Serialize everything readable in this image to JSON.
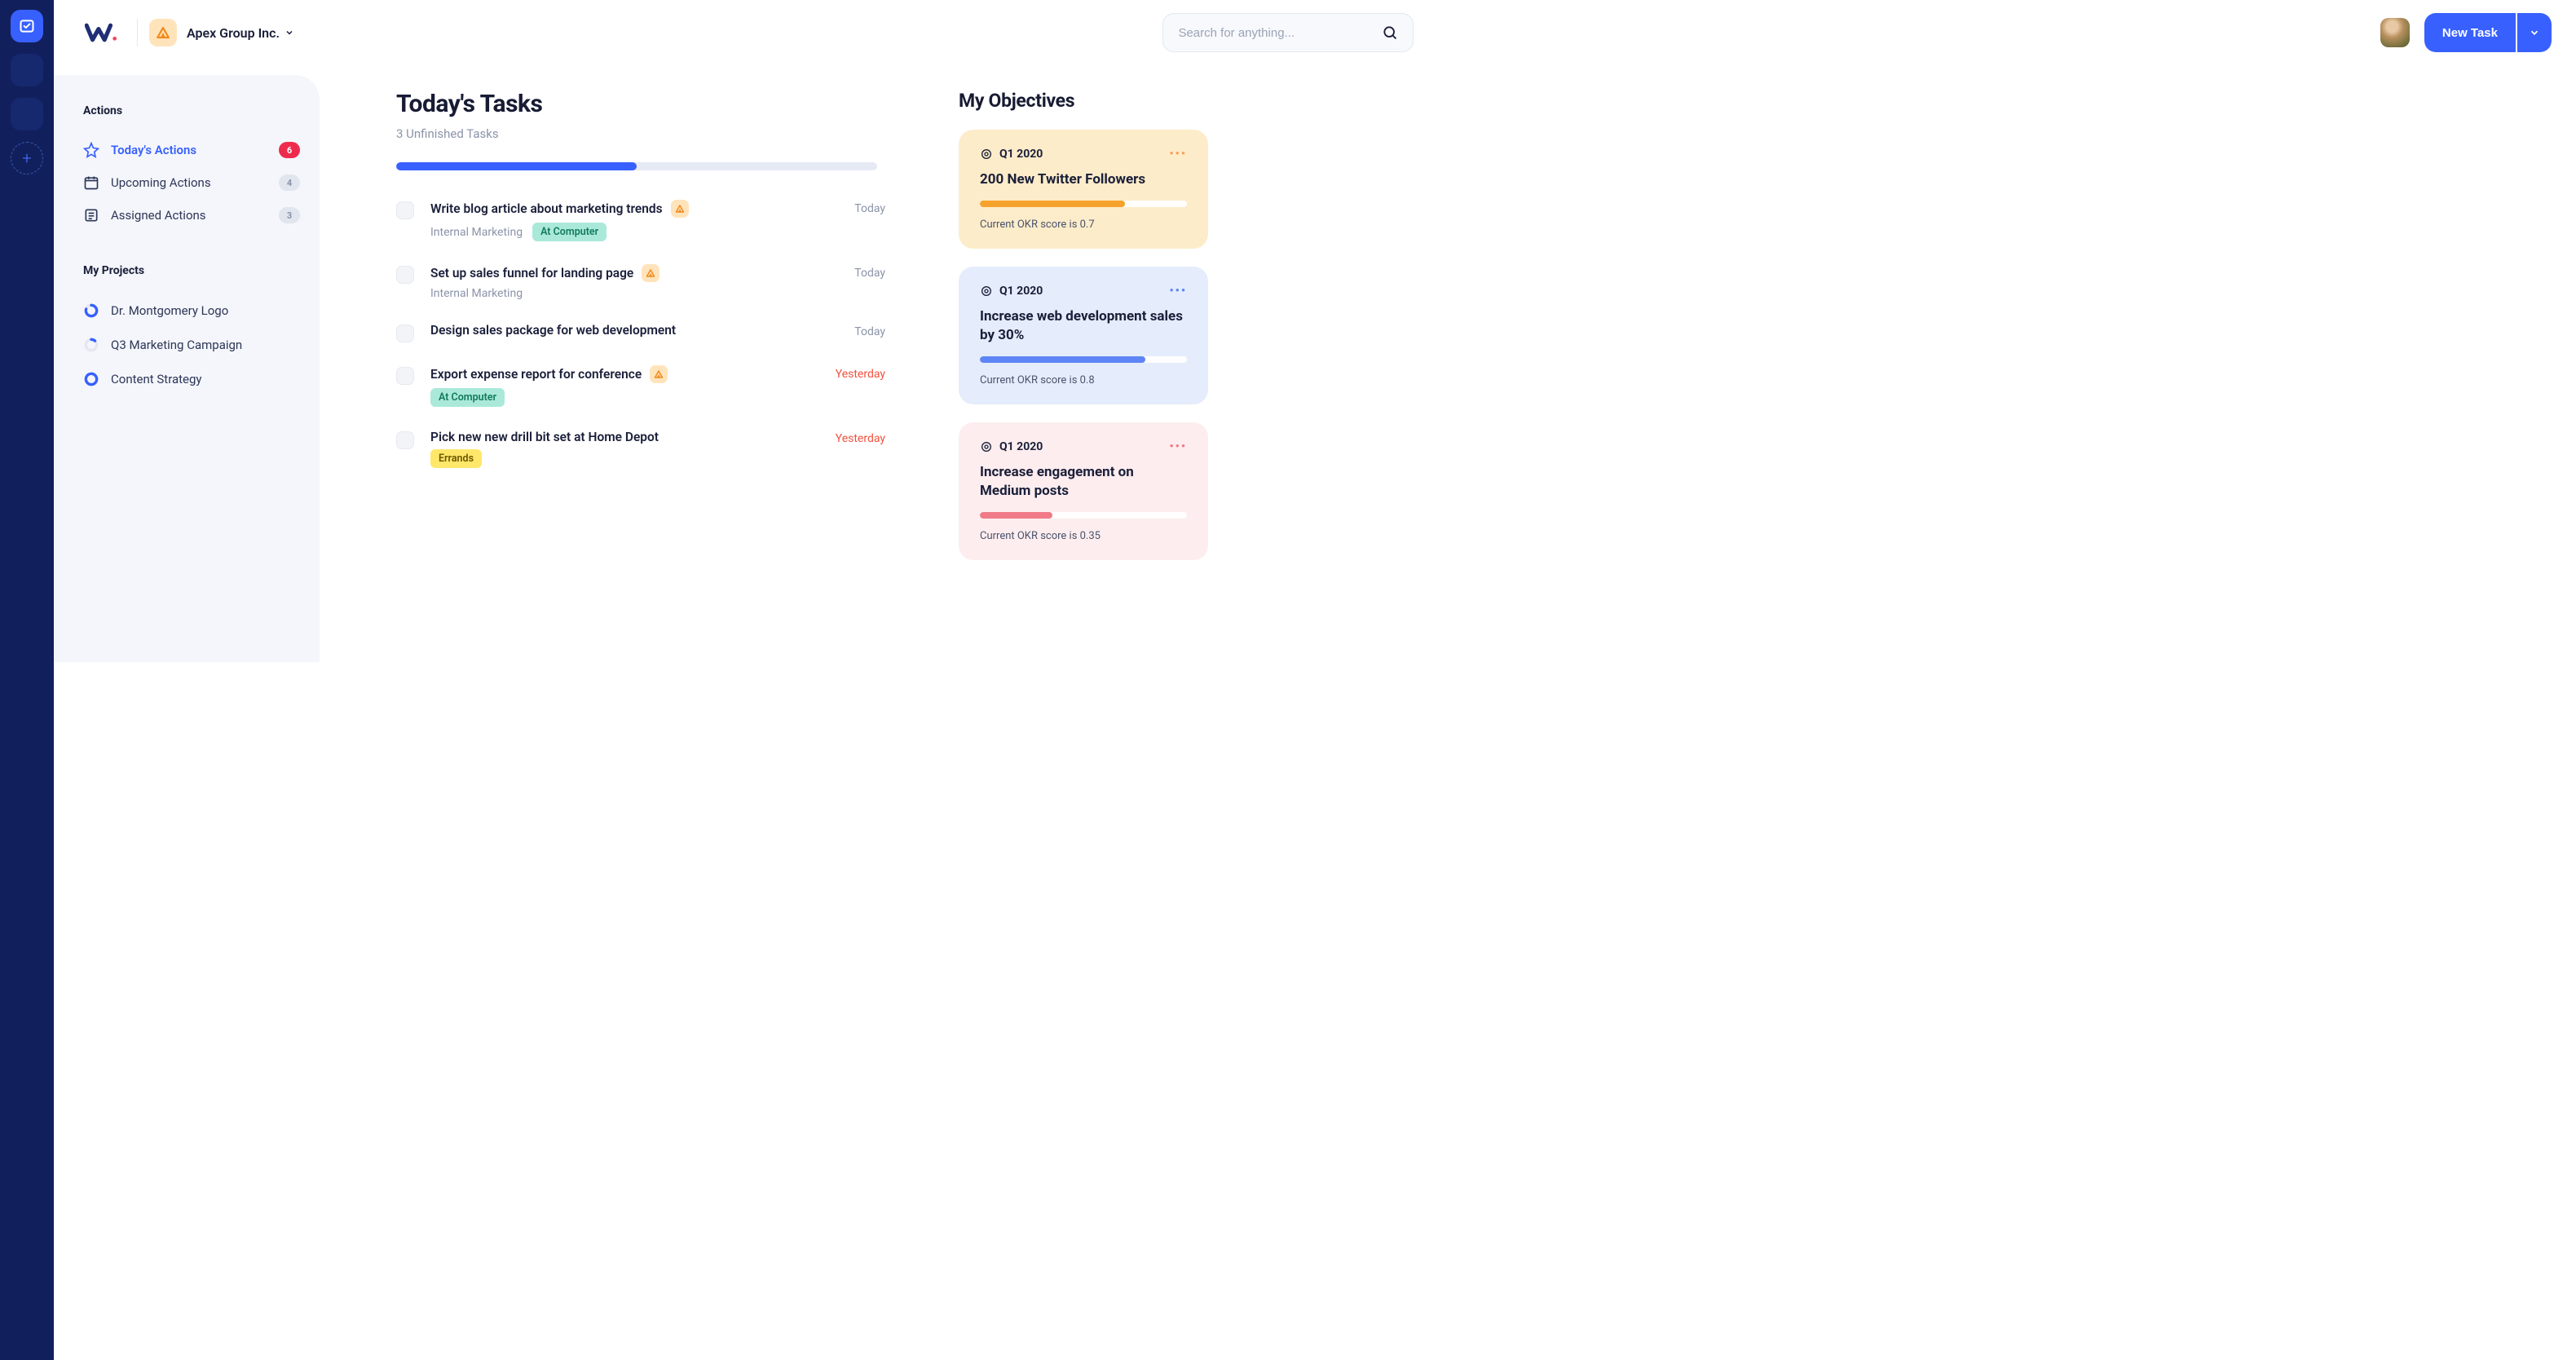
{
  "rail": {
    "plus": "+"
  },
  "header": {
    "org_name": "Apex Group Inc.",
    "search_placeholder": "Search for anything...",
    "new_task_label": "New Task"
  },
  "sidebar": {
    "actions_header": "Actions",
    "items": [
      {
        "label": "Today's Actions",
        "badge": "6"
      },
      {
        "label": "Upcoming Actions",
        "badge": "4"
      },
      {
        "label": "Assigned Actions",
        "badge": "3"
      }
    ],
    "projects_header": "My Projects",
    "projects": [
      {
        "label": "Dr. Montgomery Logo"
      },
      {
        "label": "Q3 Marketing Campaign"
      },
      {
        "label": "Content Strategy"
      }
    ]
  },
  "main": {
    "title": "Today's Tasks",
    "subtitle": "3 Unfinished Tasks",
    "progress_pct": 50,
    "tasks": [
      {
        "title": "Write blog article about marketing trends",
        "project": "Internal Marketing",
        "tag": "At Computer",
        "tag_color": "teal",
        "date": "Today",
        "overdue": false,
        "badge": true
      },
      {
        "title": "Set up sales funnel for landing page",
        "project": "Internal Marketing",
        "tag": "",
        "tag_color": "",
        "date": "Today",
        "overdue": false,
        "badge": true
      },
      {
        "title": "Design sales package for web development",
        "project": "",
        "tag": "",
        "tag_color": "",
        "date": "Today",
        "overdue": false,
        "badge": false
      },
      {
        "title": "Export expense report for conference",
        "project": "",
        "tag": "At Computer",
        "tag_color": "teal",
        "date": "Yesterday",
        "overdue": true,
        "badge": true
      },
      {
        "title": "Pick new new drill bit set at Home Depot",
        "project": "",
        "tag": "Errands",
        "tag_color": "yellow",
        "date": "Yesterday",
        "overdue": true,
        "badge": false
      }
    ]
  },
  "objectives": {
    "title": "My Objectives",
    "cards": [
      {
        "period": "Q1 2020",
        "title": "200 New Twitter Followers",
        "score_text": "Current OKR score is 0.7",
        "pct": 70
      },
      {
        "period": "Q1 2020",
        "title": "Increase web development sales by 30%",
        "score_text": "Current OKR score is 0.8",
        "pct": 80
      },
      {
        "period": "Q1 2020",
        "title": "Increase engagement on Medium posts",
        "score_text": "Current OKR score is 0.35",
        "pct": 35
      }
    ]
  }
}
